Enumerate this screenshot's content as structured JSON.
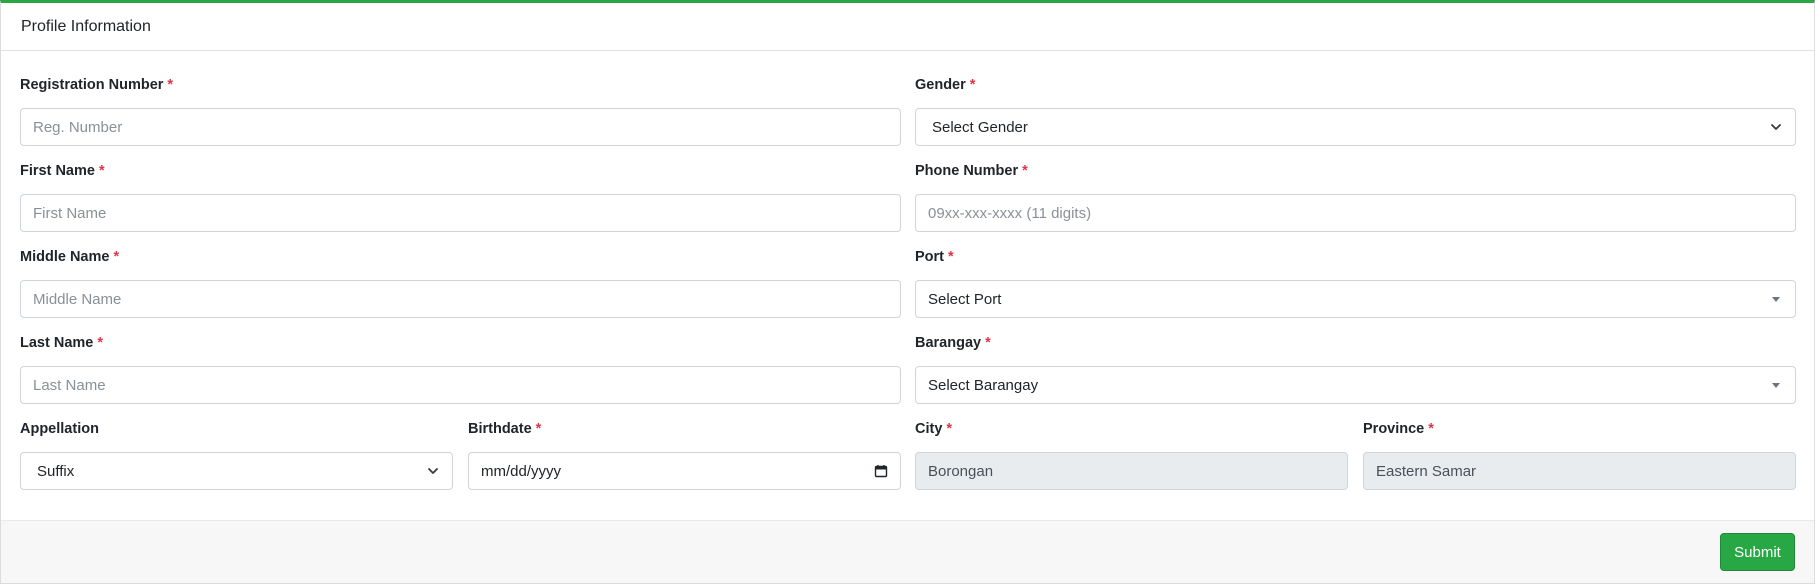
{
  "card": {
    "title": "Profile Information"
  },
  "form": {
    "registration_number": {
      "label": "Registration Number",
      "required": "*",
      "placeholder": "Reg. Number"
    },
    "gender": {
      "label": "Gender",
      "required": "*",
      "value": "Select Gender"
    },
    "first_name": {
      "label": "First Name",
      "required": "*",
      "placeholder": "First Name"
    },
    "phone_number": {
      "label": "Phone Number",
      "required": "*",
      "placeholder": "09xx-xxx-xxxx (11 digits)"
    },
    "middle_name": {
      "label": "Middle Name",
      "required": "*",
      "placeholder": "Middle Name"
    },
    "port": {
      "label": "Port",
      "required": "*",
      "value": "Select Port"
    },
    "last_name": {
      "label": "Last Name",
      "required": "*",
      "placeholder": "Last Name"
    },
    "barangay": {
      "label": "Barangay",
      "required": "*",
      "value": "Select Barangay"
    },
    "appellation": {
      "label": "Appellation",
      "value": "Suffix"
    },
    "birthdate": {
      "label": "Birthdate",
      "required": "*",
      "placeholder": "mm/dd/yyyy"
    },
    "city": {
      "label": "City",
      "required": "*",
      "value": "Borongan"
    },
    "province": {
      "label": "Province",
      "required": "*",
      "value": "Eastern Samar"
    }
  },
  "footer": {
    "submit_label": "Submit"
  },
  "icons": {
    "select_chevron": "chevron-down-icon",
    "select2_caret": "caret-down-icon",
    "calendar": "calendar-icon"
  },
  "colors": {
    "accent": "#28a745",
    "required": "#dc3545",
    "readonly_bg": "#e9ecef"
  }
}
